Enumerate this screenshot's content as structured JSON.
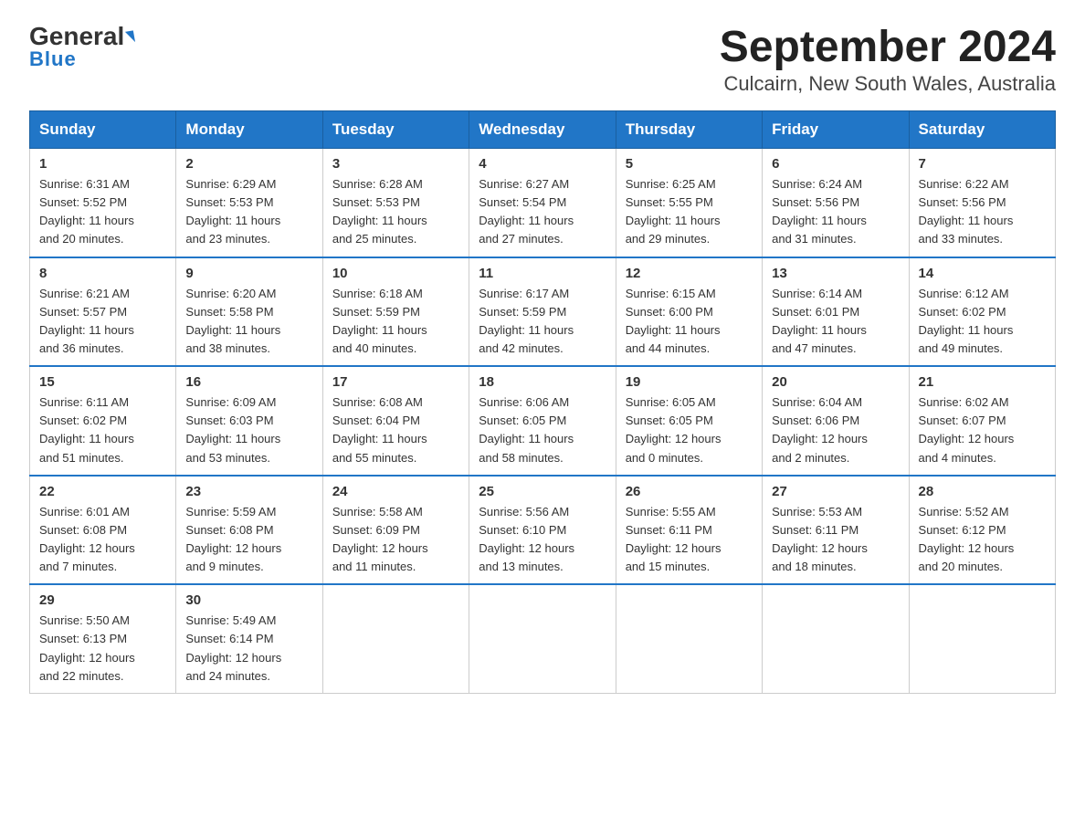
{
  "logo": {
    "general": "General",
    "blue": "Blue"
  },
  "title": "September 2024",
  "subtitle": "Culcairn, New South Wales, Australia",
  "days_of_week": [
    "Sunday",
    "Monday",
    "Tuesday",
    "Wednesday",
    "Thursday",
    "Friday",
    "Saturday"
  ],
  "weeks": [
    [
      {
        "day": "1",
        "sunrise": "6:31 AM",
        "sunset": "5:52 PM",
        "daylight": "11 hours and 20 minutes."
      },
      {
        "day": "2",
        "sunrise": "6:29 AM",
        "sunset": "5:53 PM",
        "daylight": "11 hours and 23 minutes."
      },
      {
        "day": "3",
        "sunrise": "6:28 AM",
        "sunset": "5:53 PM",
        "daylight": "11 hours and 25 minutes."
      },
      {
        "day": "4",
        "sunrise": "6:27 AM",
        "sunset": "5:54 PM",
        "daylight": "11 hours and 27 minutes."
      },
      {
        "day": "5",
        "sunrise": "6:25 AM",
        "sunset": "5:55 PM",
        "daylight": "11 hours and 29 minutes."
      },
      {
        "day": "6",
        "sunrise": "6:24 AM",
        "sunset": "5:56 PM",
        "daylight": "11 hours and 31 minutes."
      },
      {
        "day": "7",
        "sunrise": "6:22 AM",
        "sunset": "5:56 PM",
        "daylight": "11 hours and 33 minutes."
      }
    ],
    [
      {
        "day": "8",
        "sunrise": "6:21 AM",
        "sunset": "5:57 PM",
        "daylight": "11 hours and 36 minutes."
      },
      {
        "day": "9",
        "sunrise": "6:20 AM",
        "sunset": "5:58 PM",
        "daylight": "11 hours and 38 minutes."
      },
      {
        "day": "10",
        "sunrise": "6:18 AM",
        "sunset": "5:59 PM",
        "daylight": "11 hours and 40 minutes."
      },
      {
        "day": "11",
        "sunrise": "6:17 AM",
        "sunset": "5:59 PM",
        "daylight": "11 hours and 42 minutes."
      },
      {
        "day": "12",
        "sunrise": "6:15 AM",
        "sunset": "6:00 PM",
        "daylight": "11 hours and 44 minutes."
      },
      {
        "day": "13",
        "sunrise": "6:14 AM",
        "sunset": "6:01 PM",
        "daylight": "11 hours and 47 minutes."
      },
      {
        "day": "14",
        "sunrise": "6:12 AM",
        "sunset": "6:02 PM",
        "daylight": "11 hours and 49 minutes."
      }
    ],
    [
      {
        "day": "15",
        "sunrise": "6:11 AM",
        "sunset": "6:02 PM",
        "daylight": "11 hours and 51 minutes."
      },
      {
        "day": "16",
        "sunrise": "6:09 AM",
        "sunset": "6:03 PM",
        "daylight": "11 hours and 53 minutes."
      },
      {
        "day": "17",
        "sunrise": "6:08 AM",
        "sunset": "6:04 PM",
        "daylight": "11 hours and 55 minutes."
      },
      {
        "day": "18",
        "sunrise": "6:06 AM",
        "sunset": "6:05 PM",
        "daylight": "11 hours and 58 minutes."
      },
      {
        "day": "19",
        "sunrise": "6:05 AM",
        "sunset": "6:05 PM",
        "daylight": "12 hours and 0 minutes."
      },
      {
        "day": "20",
        "sunrise": "6:04 AM",
        "sunset": "6:06 PM",
        "daylight": "12 hours and 2 minutes."
      },
      {
        "day": "21",
        "sunrise": "6:02 AM",
        "sunset": "6:07 PM",
        "daylight": "12 hours and 4 minutes."
      }
    ],
    [
      {
        "day": "22",
        "sunrise": "6:01 AM",
        "sunset": "6:08 PM",
        "daylight": "12 hours and 7 minutes."
      },
      {
        "day": "23",
        "sunrise": "5:59 AM",
        "sunset": "6:08 PM",
        "daylight": "12 hours and 9 minutes."
      },
      {
        "day": "24",
        "sunrise": "5:58 AM",
        "sunset": "6:09 PM",
        "daylight": "12 hours and 11 minutes."
      },
      {
        "day": "25",
        "sunrise": "5:56 AM",
        "sunset": "6:10 PM",
        "daylight": "12 hours and 13 minutes."
      },
      {
        "day": "26",
        "sunrise": "5:55 AM",
        "sunset": "6:11 PM",
        "daylight": "12 hours and 15 minutes."
      },
      {
        "day": "27",
        "sunrise": "5:53 AM",
        "sunset": "6:11 PM",
        "daylight": "12 hours and 18 minutes."
      },
      {
        "day": "28",
        "sunrise": "5:52 AM",
        "sunset": "6:12 PM",
        "daylight": "12 hours and 20 minutes."
      }
    ],
    [
      {
        "day": "29",
        "sunrise": "5:50 AM",
        "sunset": "6:13 PM",
        "daylight": "12 hours and 22 minutes."
      },
      {
        "day": "30",
        "sunrise": "5:49 AM",
        "sunset": "6:14 PM",
        "daylight": "12 hours and 24 minutes."
      },
      null,
      null,
      null,
      null,
      null
    ]
  ],
  "labels": {
    "sunrise": "Sunrise:",
    "sunset": "Sunset:",
    "daylight": "Daylight:"
  }
}
